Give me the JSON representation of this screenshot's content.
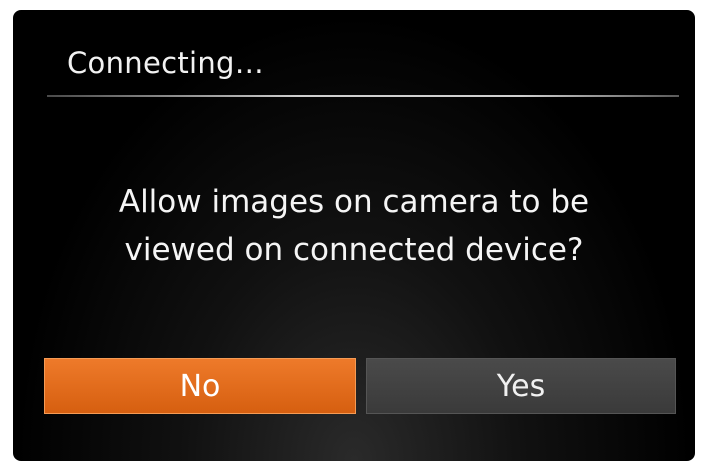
{
  "dialog": {
    "title": "Connecting…",
    "message_line1": "Allow images on camera to be",
    "message_line2": "viewed on connected device?",
    "buttons": {
      "no_label": "No",
      "yes_label": "Yes"
    },
    "selected_button": "No"
  },
  "colors": {
    "selected_button": "#e26a18",
    "unselected_button": "#424242",
    "background": "#000000",
    "text": "#f5f5f5"
  }
}
